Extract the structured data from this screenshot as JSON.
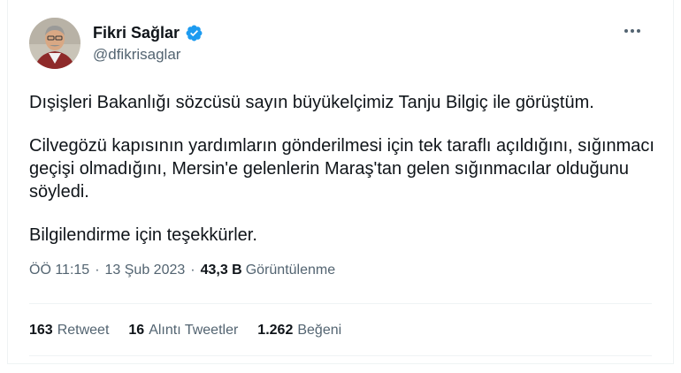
{
  "author": {
    "name": "Fikri Sağlar",
    "handle": "@dfikrisaglar",
    "verified": true,
    "verified_color": "#1d9bf0"
  },
  "tweet": {
    "paragraphs": [
      "Dışişleri Bakanlığı sözcüsü sayın büyükelçimiz Tanju Bilgiç ile görüştüm.",
      "Cilvegözü kapısının yardımların gönderilmesi için tek taraflı açıldığını, sığınmacı geçişi olmadığını, Mersin'e gelenlerin Maraş'tan gelen sığınmacılar olduğunu söyledi.",
      "Bilgilendirme için teşekkürler."
    ]
  },
  "meta": {
    "time": "ÖÖ 11:15",
    "date": "13 Şub 2023",
    "views_count": "43,3 B",
    "views_label": "Görüntülenme",
    "separator": "·"
  },
  "stats": {
    "retweets_count": "163",
    "retweets_label": "Retweet",
    "quotes_count": "16",
    "quotes_label": "Alıntı Tweetler",
    "likes_count": "1.262",
    "likes_label": "Beğeni"
  },
  "icons": {
    "verified": "verified-badge-icon",
    "more": "more-dots-icon"
  }
}
